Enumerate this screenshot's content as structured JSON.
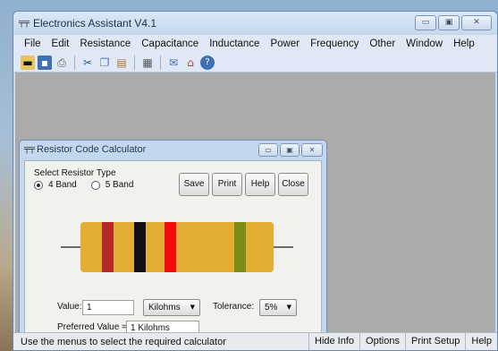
{
  "window": {
    "title": "Electronics Assistant V4.1",
    "buttons": {
      "minimize": "▭",
      "maximize": "▣",
      "close": "✕"
    }
  },
  "menu": [
    "File",
    "Edit",
    "Resistance",
    "Capacitance",
    "Inductance",
    "Power",
    "Frequency",
    "Other",
    "Window",
    "Help"
  ],
  "toolbar": {
    "icons": [
      "open-folder-icon",
      "save-icon",
      "print-icon",
      "cut-icon",
      "copy-icon",
      "paste-icon",
      "calculator-icon",
      "mail-icon",
      "home-icon",
      "help-icon"
    ]
  },
  "dialog": {
    "title": "Resistor Code Calculator",
    "select_label": "Select Resistor Type",
    "option_4band": "4 Band",
    "option_5band": "5 Band",
    "selected_option": "4 Band",
    "buttons": {
      "save": "Save",
      "print": "Print",
      "help": "Help",
      "close": "Close"
    },
    "value_label": "Value:",
    "value": "1",
    "unit": "Kilohms",
    "tolerance_label": "Tolerance:",
    "tolerance": "5%",
    "preferred_label": "Preferred Value =",
    "preferred_value": "1 Kilohms"
  },
  "resistor": {
    "body_color": "#e2ad32",
    "bands": [
      {
        "name": "band-1",
        "color": "#b5282a"
      },
      {
        "name": "band-2",
        "color": "#111111"
      },
      {
        "name": "band-3",
        "color": "#f20c0c"
      },
      {
        "name": "tolerance-band",
        "color": "#7e8d1a"
      }
    ]
  },
  "status": {
    "text": "Use the menus to select the required calculator",
    "buttons": [
      "Hide Info",
      "Options",
      "Print Setup",
      "Help"
    ]
  }
}
